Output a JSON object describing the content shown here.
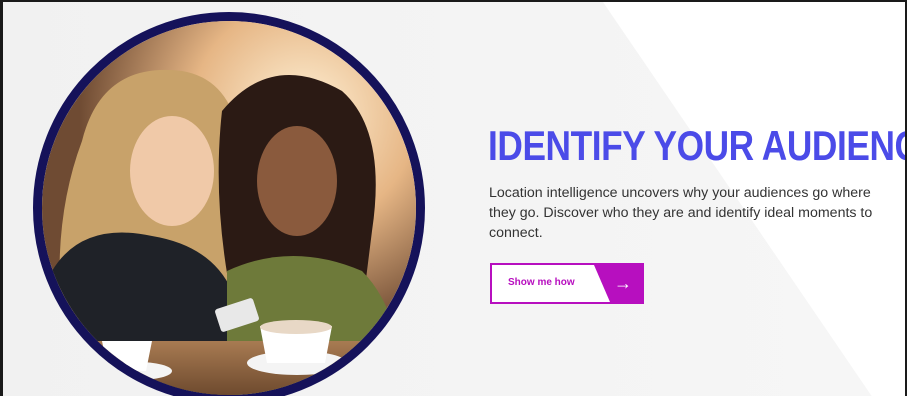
{
  "hero": {
    "headline": "IDENTIFY YOUR AUDIENCE",
    "body": "Location intelligence uncovers why your audiences go where they go. Discover who they are and identify ideal moments to connect.",
    "cta": {
      "label": "Show me how",
      "icon": "arrow-right-icon",
      "glyph": "→"
    },
    "image": {
      "subject": "two women looking at a phone at a cafe",
      "icon": "hero-photo"
    }
  },
  "colors": {
    "headline": "#4b4be8",
    "accent": "#b70fbf",
    "circle_border": "#15125a",
    "body_text": "#333333"
  }
}
